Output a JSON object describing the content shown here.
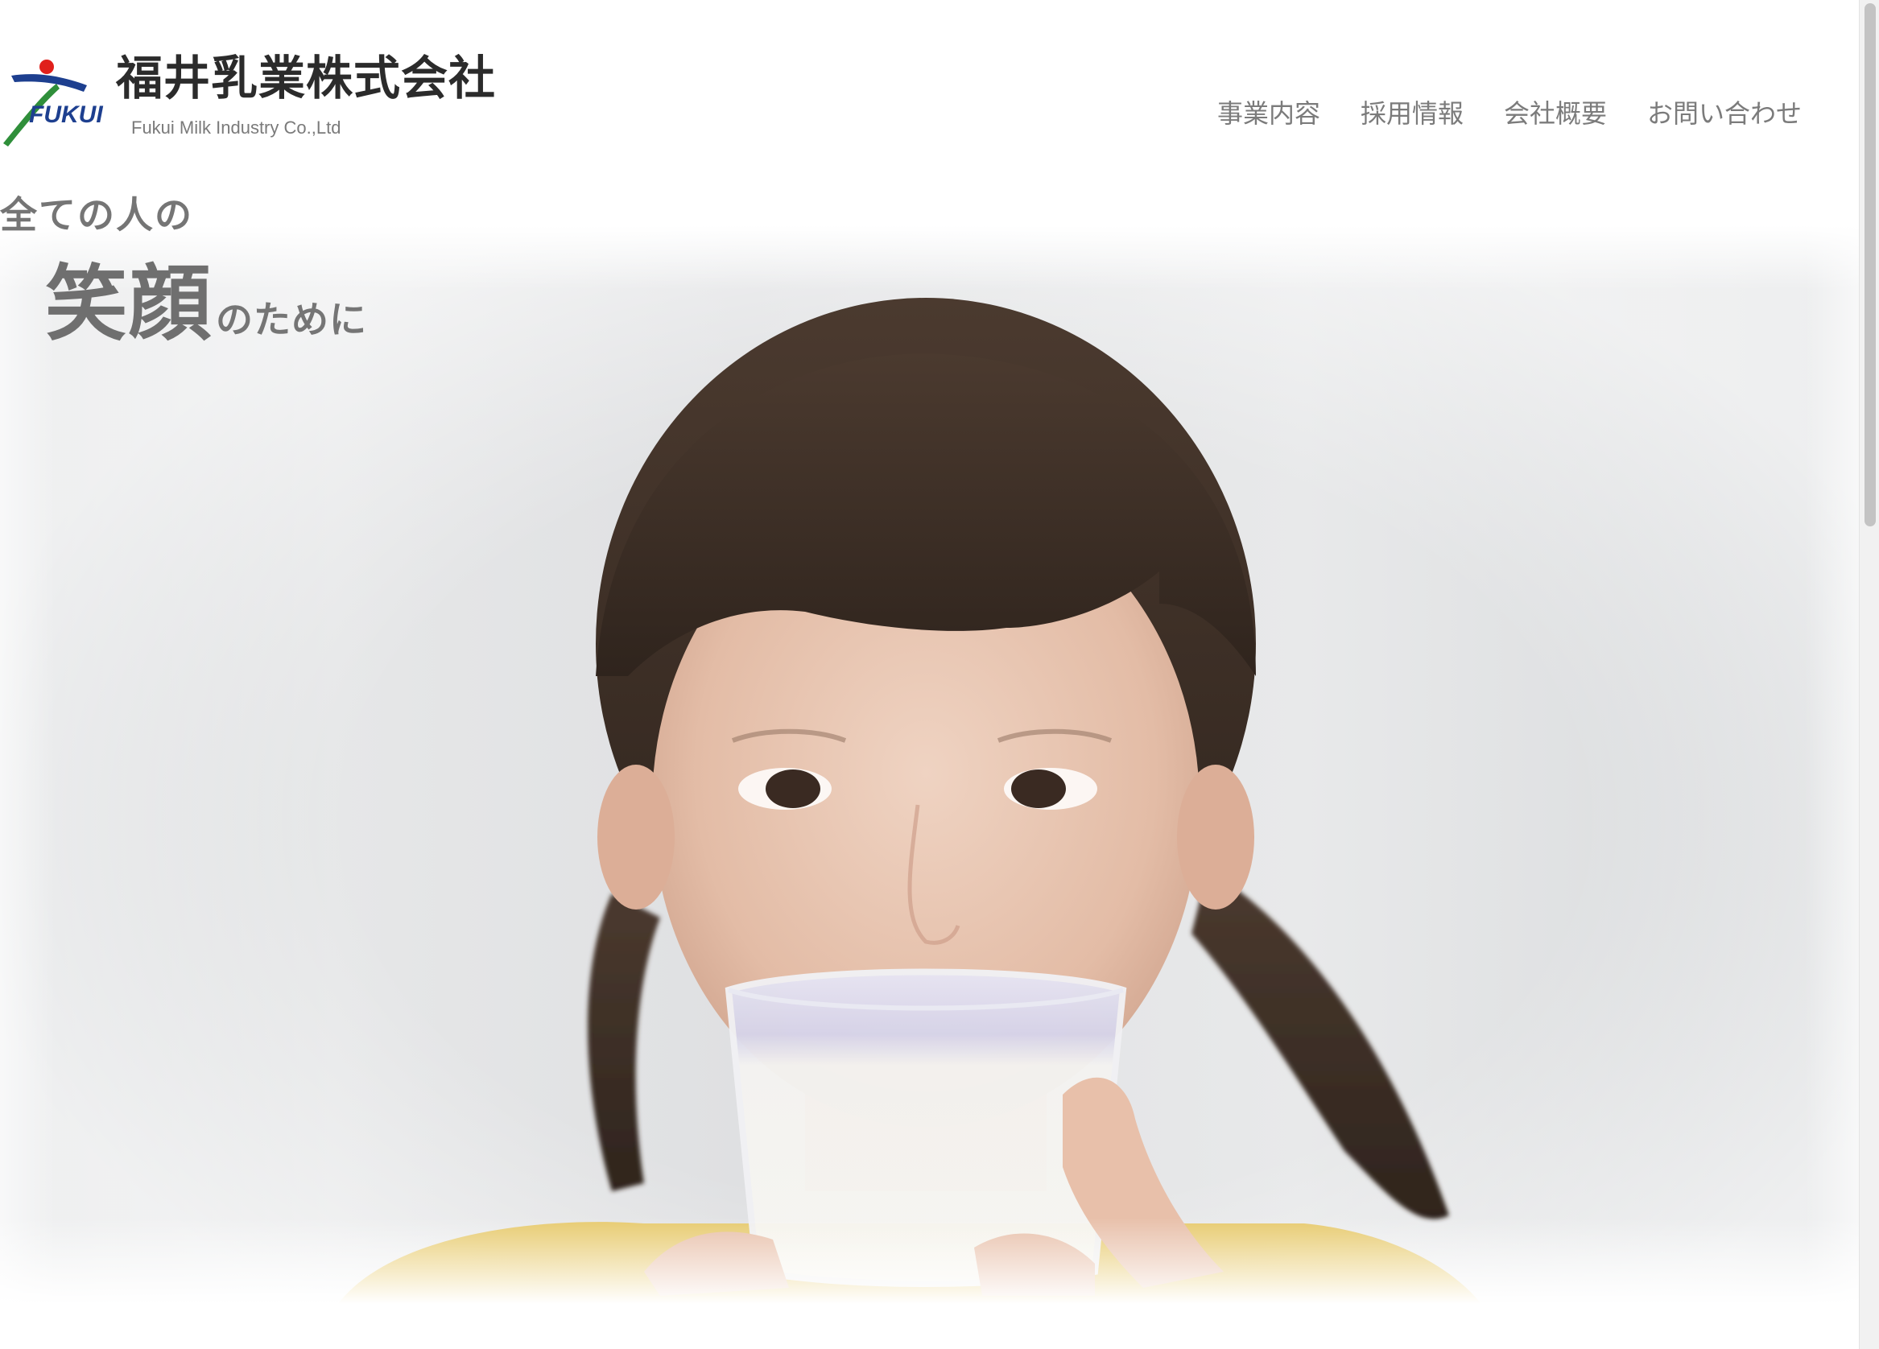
{
  "header": {
    "company_name_ja": "福井乳業株式会社",
    "company_name_en": "Fukui Milk Industry Co.,Ltd",
    "logo_text": "FUKUI",
    "logo_colors": {
      "blue": "#1d3f8f",
      "red": "#e0201b",
      "green": "#2f8f3a"
    }
  },
  "nav": {
    "items": [
      {
        "label": "事業内容"
      },
      {
        "label": "採用情報"
      },
      {
        "label": "会社概要"
      },
      {
        "label": "お問い合わせ"
      }
    ]
  },
  "hero": {
    "tagline_line1": "全ての人の",
    "tagline_big": "笑顔",
    "tagline_small": "のために",
    "image_subject": "girl drinking a glass of milk"
  }
}
